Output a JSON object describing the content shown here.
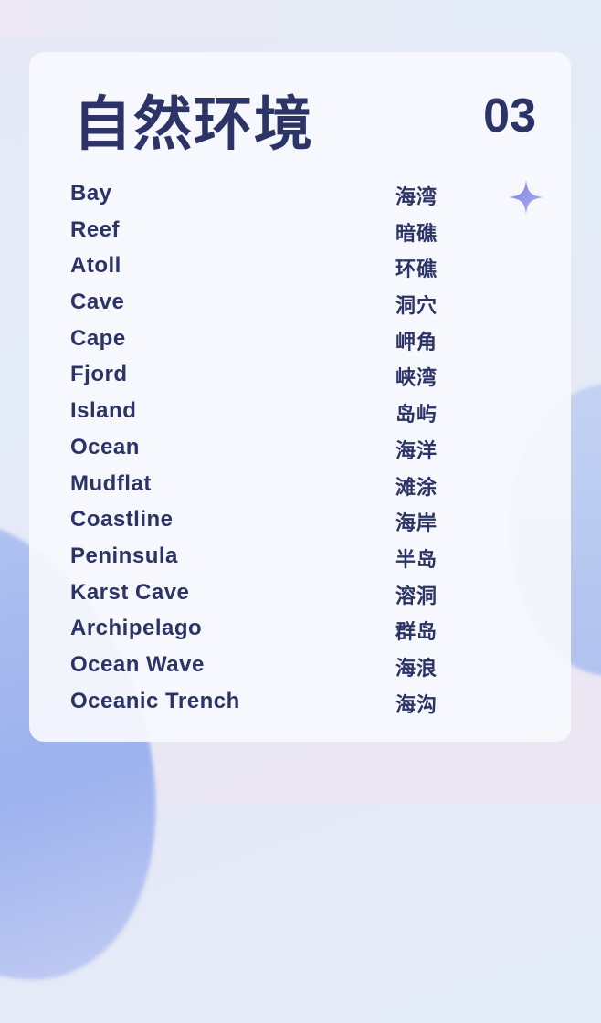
{
  "header": {
    "title": "自然环境",
    "number": "03"
  },
  "colors": {
    "text": "#2c3366",
    "sparkle": "#8e8ee6"
  },
  "icons": {
    "sparkle": "four-point-star"
  },
  "vocab": [
    {
      "en": "Bay",
      "zh": "海湾"
    },
    {
      "en": "Reef",
      "zh": "暗礁"
    },
    {
      "en": "Atoll",
      "zh": "环礁"
    },
    {
      "en": "Cave",
      "zh": "洞穴"
    },
    {
      "en": "Cape",
      "zh": "岬角"
    },
    {
      "en": "Fjord",
      "zh": "峡湾"
    },
    {
      "en": "Island",
      "zh": "岛屿"
    },
    {
      "en": "Ocean",
      "zh": "海洋"
    },
    {
      "en": "Mudflat",
      "zh": "滩涂"
    },
    {
      "en": "Coastline",
      "zh": "海岸"
    },
    {
      "en": "Peninsula",
      "zh": "半岛"
    },
    {
      "en": "Karst Cave",
      "zh": "溶洞"
    },
    {
      "en": "Archipelago",
      "zh": "群岛"
    },
    {
      "en": "Ocean Wave",
      "zh": "海浪"
    },
    {
      "en": "Oceanic Trench",
      "zh": "海沟"
    }
  ]
}
